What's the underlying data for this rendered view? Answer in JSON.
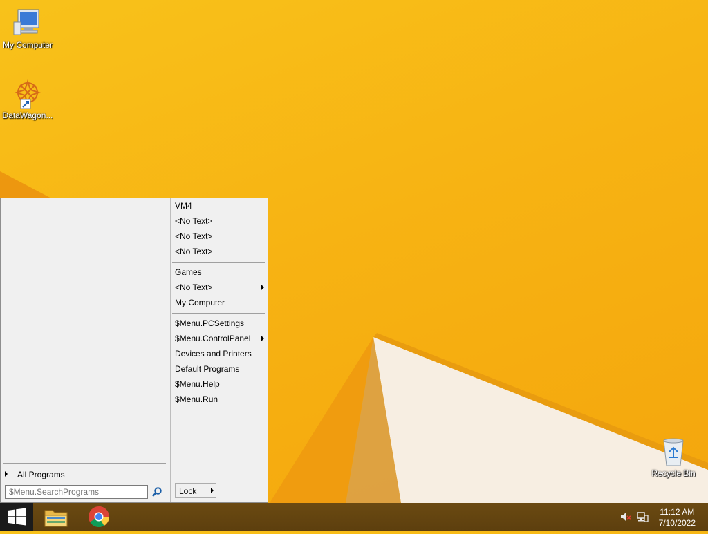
{
  "desktop": {
    "icons": [
      {
        "label": "My Computer"
      },
      {
        "label": "DataWagon..."
      },
      {
        "label": "Recycle Bin"
      }
    ]
  },
  "start_menu": {
    "all_programs_label": "All Programs",
    "search_placeholder": "$Menu.SearchPrograms",
    "right_items_group1": [
      "VM4",
      "<No Text>",
      "<No Text>",
      "<No Text>"
    ],
    "right_items_group2": [
      "Games",
      "<No Text>",
      "My Computer"
    ],
    "right_items_group3": [
      "$Menu.PCSettings",
      "$Menu.ControlPanel",
      "Devices and Printers",
      "Default Programs",
      "$Menu.Help",
      "$Menu.Run"
    ],
    "lock_label": "Lock"
  },
  "taskbar": {
    "time": "11:12 AM",
    "date": "7/10/2022",
    "pinned": [
      "file-explorer-icon",
      "chrome-icon"
    ]
  },
  "colors": {
    "wallpaper": "#f7b313",
    "taskbar": "#5d3f0e",
    "menu_bg": "#f0f0f0"
  }
}
